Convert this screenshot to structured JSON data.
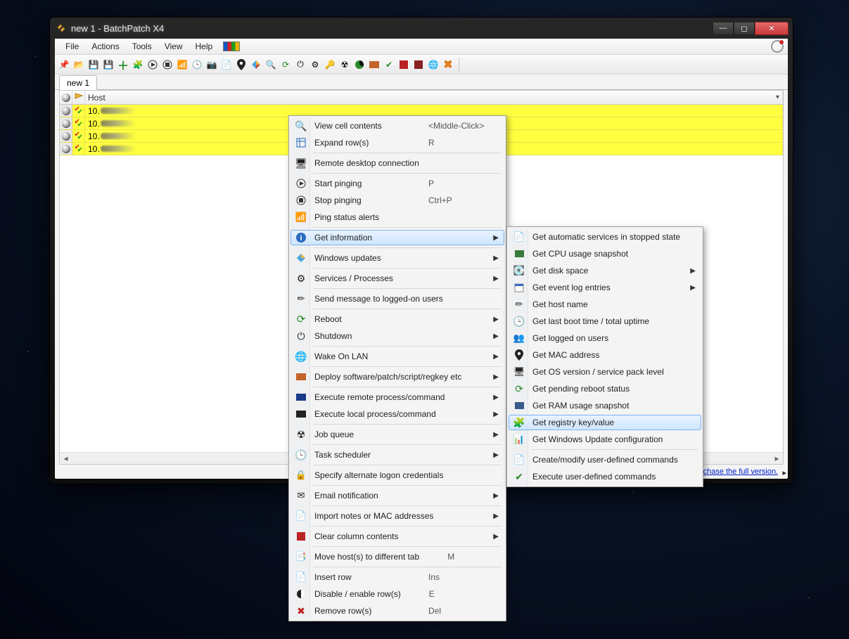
{
  "window": {
    "title": "new 1 - BatchPatch X4"
  },
  "menubar": {
    "items": [
      "File",
      "Actions",
      "Tools",
      "View",
      "Help"
    ]
  },
  "tabs": {
    "active": "new 1"
  },
  "grid": {
    "header": {
      "host": "Host"
    },
    "rows": [
      {
        "ip": "10."
      },
      {
        "ip": "10."
      },
      {
        "ip": "10."
      },
      {
        "ip": "10."
      }
    ]
  },
  "contextMenu": {
    "items": [
      {
        "label": "View cell contents",
        "shortcut": "<Middle-Click>"
      },
      {
        "label": "Expand row(s)",
        "shortcut": "R"
      },
      {
        "sep": true
      },
      {
        "label": "Remote desktop connection"
      },
      {
        "sep": true
      },
      {
        "label": "Start pinging",
        "shortcut": "P"
      },
      {
        "label": "Stop pinging",
        "shortcut": "Ctrl+P"
      },
      {
        "label": "Ping status alerts"
      },
      {
        "sep": true
      },
      {
        "label": "Get information",
        "sub": true,
        "highlight": true
      },
      {
        "sep": true
      },
      {
        "label": "Windows updates",
        "sub": true
      },
      {
        "sep": true
      },
      {
        "label": "Services / Processes",
        "sub": true
      },
      {
        "sep": true
      },
      {
        "label": "Send message to logged-on users"
      },
      {
        "sep": true
      },
      {
        "label": "Reboot",
        "sub": true
      },
      {
        "label": "Shutdown",
        "sub": true
      },
      {
        "sep": true
      },
      {
        "label": "Wake On LAN",
        "sub": true
      },
      {
        "sep": true
      },
      {
        "label": "Deploy software/patch/script/regkey etc",
        "sub": true
      },
      {
        "sep": true
      },
      {
        "label": "Execute remote process/command",
        "sub": true
      },
      {
        "label": "Execute local process/command",
        "sub": true
      },
      {
        "sep": true
      },
      {
        "label": "Job queue",
        "sub": true
      },
      {
        "sep": true
      },
      {
        "label": "Task scheduler",
        "sub": true
      },
      {
        "sep": true
      },
      {
        "label": "Specify alternate logon credentials"
      },
      {
        "sep": true
      },
      {
        "label": "Email notification",
        "sub": true
      },
      {
        "sep": true
      },
      {
        "label": "Import notes or MAC addresses",
        "sub": true
      },
      {
        "sep": true
      },
      {
        "label": "Clear column contents",
        "sub": true
      },
      {
        "sep": true
      },
      {
        "label": "Move host(s) to different tab",
        "shortcut": "M"
      },
      {
        "sep": true
      },
      {
        "label": "Insert row",
        "shortcut": "Ins"
      },
      {
        "label": "Disable / enable row(s)",
        "shortcut": "E"
      },
      {
        "label": "Remove row(s)",
        "shortcut": "Del"
      }
    ]
  },
  "submenu": {
    "items": [
      {
        "label": "Get automatic services in stopped state"
      },
      {
        "label": "Get CPU usage snapshot"
      },
      {
        "label": "Get disk space",
        "sub": true
      },
      {
        "label": "Get event log entries",
        "sub": true
      },
      {
        "label": "Get host name"
      },
      {
        "label": "Get last boot time / total uptime"
      },
      {
        "label": "Get logged on users"
      },
      {
        "label": "Get MAC address"
      },
      {
        "label": "Get OS version / service pack level"
      },
      {
        "label": "Get pending reboot status"
      },
      {
        "label": "Get RAM usage snapshot"
      },
      {
        "label": "Get registry key/value",
        "highlight": true
      },
      {
        "label": "Get Windows Update configuration"
      },
      {
        "sep": true
      },
      {
        "label": "Create/modify user-defined commands"
      },
      {
        "label": "Execute user-defined commands"
      }
    ]
  },
  "evalBar": {
    "text": "This is the evaluation version of BatchPatch.  Click to purchase the full version."
  }
}
